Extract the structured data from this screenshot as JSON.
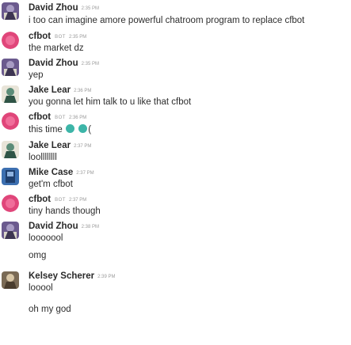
{
  "bot_tag": "BOT",
  "messages": [
    {
      "type": "header",
      "avatar": "david",
      "name": "David Zhou",
      "time": "2:35 PM"
    },
    {
      "type": "line",
      "text": "i too can imagine amore powerful chatroom program to replace cfbot"
    },
    {
      "type": "header",
      "avatar": "cfbot",
      "name": "cfbot",
      "bot": true,
      "time": "2:35 PM"
    },
    {
      "type": "line",
      "text": "the market dz"
    },
    {
      "type": "header",
      "avatar": "david",
      "name": "David Zhou",
      "time": "2:35 PM"
    },
    {
      "type": "line",
      "text": "yep"
    },
    {
      "type": "header",
      "avatar": "jake",
      "name": "Jake Lear",
      "time": "2:36 PM"
    },
    {
      "type": "line",
      "text": "you gonna let him talk to u like that cfbot"
    },
    {
      "type": "header",
      "avatar": "cfbot",
      "name": "cfbot",
      "bot": true,
      "time": "2:36 PM"
    },
    {
      "type": "line",
      "text": "this time",
      "emoji_after": true,
      "suffix": "("
    },
    {
      "type": "header",
      "avatar": "jake",
      "name": "Jake Lear",
      "time": "2:37 PM"
    },
    {
      "type": "line",
      "text": "loollllllll"
    },
    {
      "type": "header",
      "avatar": "mike",
      "name": "Mike Case",
      "time": "2:37 PM"
    },
    {
      "type": "line",
      "text": "get'm cfbot"
    },
    {
      "type": "header",
      "avatar": "cfbot",
      "name": "cfbot",
      "bot": true,
      "time": "2:37 PM"
    },
    {
      "type": "line",
      "text": "tiny hands though"
    },
    {
      "type": "header",
      "avatar": "david",
      "name": "David Zhou",
      "time": "2:38 PM"
    },
    {
      "type": "line",
      "text": "looooool"
    },
    {
      "type": "line",
      "text": "omg"
    },
    {
      "type": "header",
      "avatar": "kelsey",
      "name": "Kelsey Scherer",
      "time": "2:39 PM"
    },
    {
      "type": "line",
      "text": "looool"
    },
    {
      "type": "line",
      "text": "oh my god"
    }
  ],
  "colors": {
    "david": "#6b5a8e",
    "cfbot": "#e0467a",
    "jake": "#5b8c78",
    "mike": "#3c6fb0",
    "kelsey": "#7a6a55",
    "muted": "#9b9b9b",
    "emoji": "#3db5a8"
  }
}
